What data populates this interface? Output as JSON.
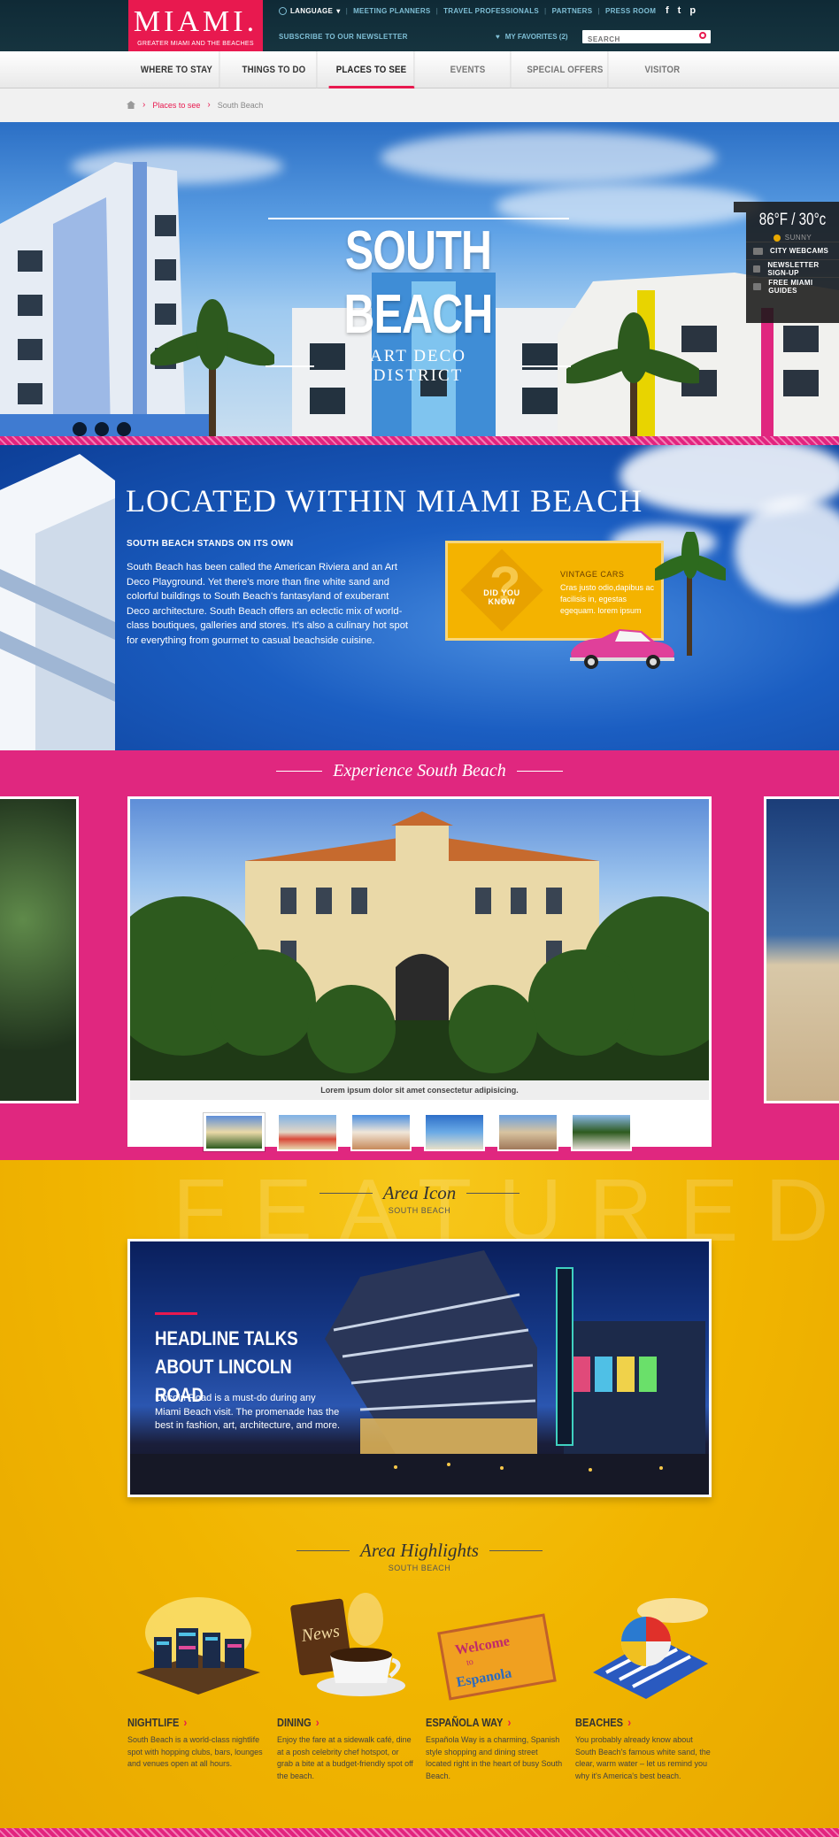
{
  "topbar": {
    "logo_main": "MIAMI.",
    "logo_sub": "GREATER MIAMI AND THE BEACHES",
    "language": "LANGUAGE",
    "links": [
      "MEETING PLANNERS",
      "TRAVEL PROFESSIONALS",
      "PARTNERS",
      "PRESS ROOM"
    ],
    "newsletter": "SUBSCRIBE TO OUR NEWSLETTER",
    "favorites": "MY FAVORITES (2)",
    "search_placeholder": "SEARCH",
    "social": [
      "f",
      "t",
      "p"
    ]
  },
  "nav": {
    "items": [
      "WHERE TO STAY",
      "THINGS TO DO",
      "PLACES TO SEE",
      "EVENTS",
      "SPECIAL OFFERS",
      "VISITOR RESOURCES"
    ]
  },
  "breadcrumb": {
    "current": "Places to see",
    "page": "South Beach"
  },
  "hero": {
    "title": "SOUTH BEACH",
    "subtitle": "ART DECO DISTRICT"
  },
  "weather": {
    "temp": "86°F / 30°c",
    "condition": "SUNNY",
    "items": [
      "CITY WEBCAMS",
      "NEWSLETTER SIGN-UP",
      "FREE MIAMI GUIDES"
    ]
  },
  "located": {
    "title": "LOCATED WITHIN MIAMI BEACH",
    "subtitle": "SOUTH BEACH STANDS ON ITS OWN",
    "body": "South Beach has been called the American Riviera and an Art Deco Playground. Yet there's more than fine white sand and colorful buildings to South Beach's fantasyland of exuberant Deco architecture. South Beach offers an eclectic mix of world-class boutiques, galleries and stores. It's also a culinary hot spot for everything from gourmet to casual beachside cuisine."
  },
  "did_you_know": {
    "label": "DID YOU KNOW",
    "title": "VINTAGE CARS",
    "body": "Cras justo odio,dapibus ac facilisis in, egestas egequam. lorem ipsum"
  },
  "experience": {
    "title": "Experience South Beach",
    "caption": "Lorem ipsum dolor sit amet consectetur adipisicing.",
    "thumb_count": 6
  },
  "featured": {
    "watermark": "FEATURED",
    "area_icon_title": "Area Icon",
    "area_icon_sub": "SOUTH BEACH",
    "lincoln_title": "HEADLINE TALKS ABOUT LINCOLN ROAD",
    "lincoln_body": "Lincoln Road is a must-do during any Miami Beach visit. The promenade has the best in fashion, art, architecture, and more."
  },
  "highlights": {
    "title": "Area Highlights",
    "sub": "SOUTH BEACH",
    "items": [
      {
        "title": "NIGHTLIFE",
        "body": "South Beach is a world-class nightlife spot with hopping clubs, bars, lounges and venues open at all hours."
      },
      {
        "title": "DINING",
        "body": "Enjoy the fare at a sidewalk café, dine at a posh celebrity chef hotspot, or grab a bite at a budget-friendly spot off the beach."
      },
      {
        "title": "ESPAÑOLA WAY",
        "body": "Española Way is a charming, Spanish style shopping and dining street located right in the heart of busy South Beach."
      },
      {
        "title": "BEACHES",
        "body": "You probably already know about South Beach's famous white sand, the clear, warm water – let us remind you why it's America's best beach."
      }
    ]
  },
  "colors": {
    "brand_pink": "#e8194f",
    "section_pink": "#e0277f",
    "gold": "#f1b500",
    "topbar": "#14303c"
  }
}
